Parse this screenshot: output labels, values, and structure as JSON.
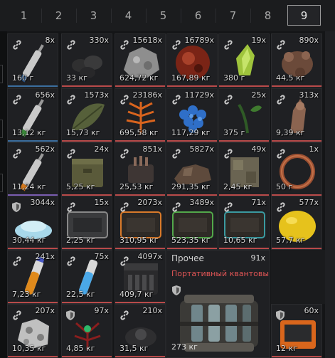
{
  "tabs": [
    {
      "label": "1",
      "active": false
    },
    {
      "label": "2",
      "active": false
    },
    {
      "label": "3",
      "active": false
    },
    {
      "label": "4",
      "active": false
    },
    {
      "label": "5",
      "active": false
    },
    {
      "label": "6",
      "active": false
    },
    {
      "label": "7",
      "active": false
    },
    {
      "label": "8",
      "active": false
    },
    {
      "label": "9",
      "active": true
    }
  ],
  "items": [
    {
      "count": "8x",
      "weight": "160 г",
      "icon": "link-icon",
      "art": "syringe",
      "underline": "#3b6e9e"
    },
    {
      "count": "330x",
      "weight": "33 кг",
      "icon": "link-icon",
      "art": "dark-rocks",
      "underline": "#b94a4a"
    },
    {
      "count": "15618x",
      "weight": "624,72 кг",
      "icon": "link-icon",
      "art": "gray-ore",
      "underline": "#b94a4a"
    },
    {
      "count": "16789x",
      "weight": "167,89 кг",
      "icon": "link-icon",
      "art": "red-sphere",
      "underline": "#b94a4a"
    },
    {
      "count": "19x",
      "weight": "380 г",
      "icon": "link-icon",
      "art": "green-crystal",
      "underline": "#b94a4a"
    },
    {
      "count": "890x",
      "weight": "44,5 кг",
      "icon": "link-icon",
      "art": "brown-root",
      "underline": "#b94a4a"
    },
    {
      "count": "656x",
      "weight": "13,12 кг",
      "icon": "link-icon",
      "art": "syringe-green",
      "underline": "#3b6e9e"
    },
    {
      "count": "1573x",
      "weight": "15,73 кг",
      "icon": "link-icon",
      "art": "leaf",
      "underline": "#b94a4a"
    },
    {
      "count": "23186x",
      "weight": "695,58 кг",
      "icon": "link-icon",
      "art": "orange-fern",
      "underline": "#b94a4a"
    },
    {
      "count": "11729x",
      "weight": "117,29 кг",
      "icon": "link-icon",
      "art": "blue-crystals",
      "underline": "#b94a4a"
    },
    {
      "count": "25x",
      "weight": "375 г",
      "icon": "link-icon",
      "art": "green-sprout",
      "underline": "#b94a4a"
    },
    {
      "count": "313x",
      "weight": "9,39 кг",
      "icon": "link-icon",
      "art": "brown-root2",
      "underline": "#b94a4a"
    },
    {
      "count": "562x",
      "weight": "11,24 кг",
      "icon": "link-icon",
      "art": "syringe-orange",
      "underline": "#7a5cb0"
    },
    {
      "count": "24x",
      "weight": "5,25 кг",
      "icon": "link-icon",
      "art": "ammo-box",
      "underline": "#b94a4a"
    },
    {
      "count": "851x",
      "weight": "25,53 кг",
      "icon": "link-icon",
      "art": "device",
      "underline": "#b94a4a"
    },
    {
      "count": "5827x",
      "weight": "291,35 кг",
      "icon": "link-icon",
      "art": "brown-chunks",
      "underline": "#b94a4a"
    },
    {
      "count": "49x",
      "weight": "2,45 кг",
      "icon": "link-icon",
      "art": "stone-block",
      "underline": "#b94a4a"
    },
    {
      "count": "1x",
      "weight": "50 г",
      "icon": "link-icon",
      "art": "ring",
      "underline": "#b94a4a"
    },
    {
      "count": "3044x",
      "weight": "30,44 кг",
      "icon": "shield-icon",
      "art": "blue-powder",
      "underline": "#b94a4a"
    },
    {
      "count": "15x",
      "weight": "2,25 кг",
      "icon": "link-icon",
      "art": "gray-case",
      "underline": "#b94a4a"
    },
    {
      "count": "2073x",
      "weight": "310,95 кг",
      "icon": "link-icon",
      "art": "orange-case",
      "underline": "#b94a4a"
    },
    {
      "count": "3489x",
      "weight": "523,35 кг",
      "icon": "link-icon",
      "art": "green-case",
      "underline": "#b94a4a"
    },
    {
      "count": "71x",
      "weight": "10,65 кг",
      "icon": "link-icon",
      "art": "teal-case",
      "underline": "#b94a4a"
    },
    {
      "count": "577x",
      "weight": "57,7 кг",
      "icon": "link-icon",
      "art": "lemon",
      "underline": "#b94a4a"
    },
    {
      "count": "241x",
      "weight": "7,23 кг",
      "icon": "link-icon",
      "art": "orange-vial",
      "underline": "#b94a4a"
    },
    {
      "count": "75x",
      "weight": "22,5 кг",
      "icon": "link-icon",
      "art": "blue-vial",
      "underline": "#b94a4a"
    },
    {
      "count": "4097x",
      "weight": "409,7 кг",
      "icon": "link-icon",
      "art": "battery",
      "underline": "#b94a4a"
    },
    {
      "count": "207x",
      "weight": "10,35 кг",
      "icon": "link-icon",
      "art": "silver-chunk",
      "underline": "#b94a4a"
    },
    {
      "count": "97x",
      "weight": "4,85 кг",
      "icon": "shield-icon",
      "art": "red-plant",
      "underline": "#b94a4a"
    },
    {
      "count": "210x",
      "weight": "31,5 кг",
      "icon": "link-icon",
      "art": "dark-part",
      "underline": "#b94a4a"
    },
    {
      "count": "60x",
      "weight": "12 кг",
      "icon": "shield-icon",
      "art": "orange-tablet",
      "underline": "#b94a4a"
    }
  ],
  "featured": {
    "title": "Прочее",
    "count": "91x",
    "subtitle": "Портативный квантовы..",
    "weight": "273 кг",
    "icon": "shield-icon",
    "subtitle_color": "#e05555"
  }
}
